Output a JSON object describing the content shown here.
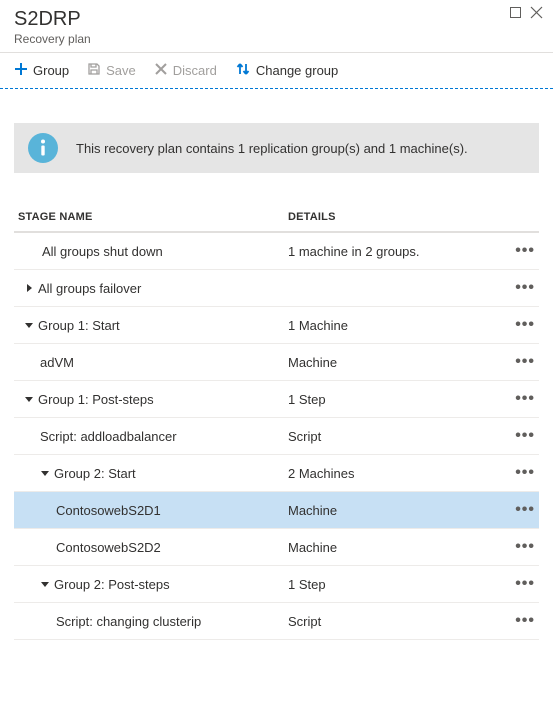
{
  "header": {
    "title": "S2DRP",
    "subtitle": "Recovery plan"
  },
  "toolbar": {
    "group": "Group",
    "save": "Save",
    "discard": "Discard",
    "change_group": "Change group"
  },
  "info": {
    "text": "This recovery plan contains 1 replication group(s) and 1 machine(s)."
  },
  "columns": {
    "name": "STAGE NAME",
    "details": "DETAILS"
  },
  "rows": [
    {
      "name": "All groups shut down",
      "details": "1 machine in 2 groups.",
      "indent": 0,
      "caret": "none",
      "selected": false
    },
    {
      "name": "All groups failover",
      "details": "",
      "indent": 1,
      "caret": "right",
      "selected": false
    },
    {
      "name": "Group 1: Start",
      "details": "1 Machine",
      "indent": 1,
      "caret": "down",
      "selected": false
    },
    {
      "name": "adVM",
      "details": "Machine",
      "indent": 2,
      "caret": "none",
      "selected": false
    },
    {
      "name": "Group 1: Post-steps",
      "details": "1 Step",
      "indent": 1,
      "caret": "down",
      "selected": false
    },
    {
      "name": "Script: addloadbalancer",
      "details": "Script",
      "indent": 2,
      "caret": "none",
      "selected": false
    },
    {
      "name": "Group 2: Start",
      "details": "2 Machines",
      "indent": 2,
      "caret": "down",
      "selected": false
    },
    {
      "name": "ContosowebS2D1",
      "details": "Machine",
      "indent": 3,
      "caret": "none",
      "selected": true
    },
    {
      "name": "ContosowebS2D2",
      "details": "Machine",
      "indent": 3,
      "caret": "none",
      "selected": false
    },
    {
      "name": "Group 2: Post-steps",
      "details": "1 Step",
      "indent": 2,
      "caret": "down",
      "selected": false
    },
    {
      "name": "Script: changing clusterip",
      "details": "Script",
      "indent": 3,
      "caret": "none",
      "selected": false
    }
  ]
}
